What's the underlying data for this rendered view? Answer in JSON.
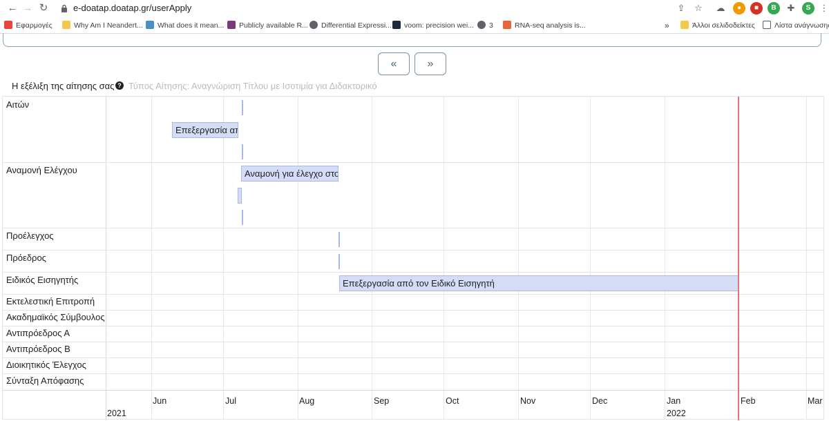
{
  "browser": {
    "url": "e-doatap.doatap.gr/userApply",
    "bookmarks": [
      {
        "label": "Εφαρμογές",
        "color": "#e8453c"
      },
      {
        "label": "Why Am I Neandert...",
        "color": "#f2c94c"
      },
      {
        "label": "What does it mean...",
        "color": "#4a90c2"
      },
      {
        "label": "Publicly available R...",
        "color": "#7a3b7a"
      },
      {
        "label": "Differential Expressi...",
        "color": "#5f6368"
      },
      {
        "label": "voom: precision wei...",
        "color": "#1b2a3a"
      },
      {
        "label": "3",
        "color": "#5f6368"
      },
      {
        "label": "RNA-seq analysis is...",
        "color": "#e8643c"
      }
    ],
    "bookmarks_more": "»",
    "other_bookmarks": "Άλλοι σελιδοδείκτες",
    "reading_list": "Λίστα ανάγνωσης",
    "profile_initial": "S"
  },
  "pager": {
    "prev": "«",
    "next": "»"
  },
  "timeline": {
    "title": "Η εξέλιξη της αίτησης σας",
    "help": "?",
    "application_type": "Τύπος Αίτησης: Αναγνώριση Τίτλου με Ισοτιμία για Διδακτορικό",
    "rows": [
      "Αιτών",
      "Αναμονή Ελέγχου",
      "Προέλεγχος",
      "Πρόεδρος",
      "Ειδικός Εισηγητής",
      "Εκτελεστική Επιτροπή",
      "Ακαδημαϊκός Σύμβουλος",
      "Αντιπρόεδρος Α",
      "Αντιπρόεδρος Β",
      "Διοικητικός Έλεγχος",
      "Σύνταξη Απόφασης"
    ],
    "months": [
      "Jun",
      "Jul",
      "Aug",
      "Sep",
      "Oct",
      "Nov",
      "Dec",
      "Jan",
      "Feb",
      "Mar"
    ],
    "years": [
      "2021",
      "2022"
    ],
    "bars": [
      {
        "row": "Αιτών",
        "label": "Επεξεργασία απ"
      },
      {
        "row": "Αναμονή Ελέγχου",
        "label": "Αναμονή για έλεγχο στο"
      },
      {
        "row": "Ειδικός Εισηγητής",
        "label": "Επεξεργασία από τον Ειδικό Εισηγητή"
      }
    ]
  }
}
